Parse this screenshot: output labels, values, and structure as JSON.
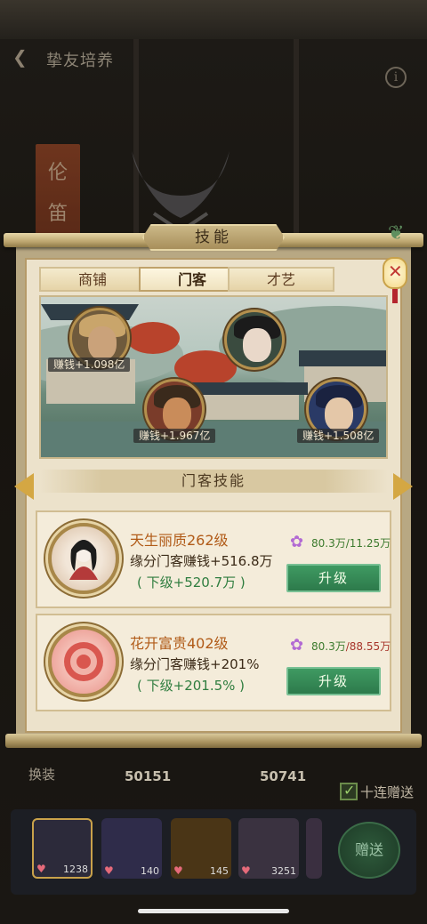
{
  "nav": {
    "title": "挚友培养",
    "info_icon": "i"
  },
  "background": {
    "banner_char_1": "伦",
    "banner_char_2": "笛"
  },
  "dialog": {
    "title": "技能",
    "tabs": [
      {
        "label": "商铺",
        "active": false
      },
      {
        "label": "门客",
        "active": true
      },
      {
        "label": "才艺",
        "active": false
      }
    ],
    "retainers": [
      {
        "earning": "赚钱+1.098亿"
      },
      {
        "earning": "赚钱+1.967亿"
      },
      {
        "earning": "赚钱+1.508亿"
      }
    ],
    "section_title": "门客技能",
    "skills": [
      {
        "name": "天生丽质262级",
        "desc": "缘分门客赚钱+516.8万",
        "next": "( 下级+520.7万 )",
        "cost_have": "80.3万",
        "cost_need": "/11.25万",
        "button": "升级"
      },
      {
        "name": "花开富贵402级",
        "desc": "缘分门客赚钱+201%",
        "next": "( 下级+201.5% )",
        "cost_have": "80.3万",
        "cost_need": "/88.55万",
        "button": "升级"
      }
    ]
  },
  "bottom": {
    "swap_label": "换装",
    "scores": [
      "50151",
      "50741"
    ],
    "ten_label": "十连赠送",
    "gift_counts": [
      "1238",
      "140",
      "145",
      "3251"
    ],
    "send_label": "赠送"
  },
  "colors": {
    "accent_green": "#2d7a4b",
    "gold": "#d4a743",
    "title_brown": "#b15b18"
  }
}
